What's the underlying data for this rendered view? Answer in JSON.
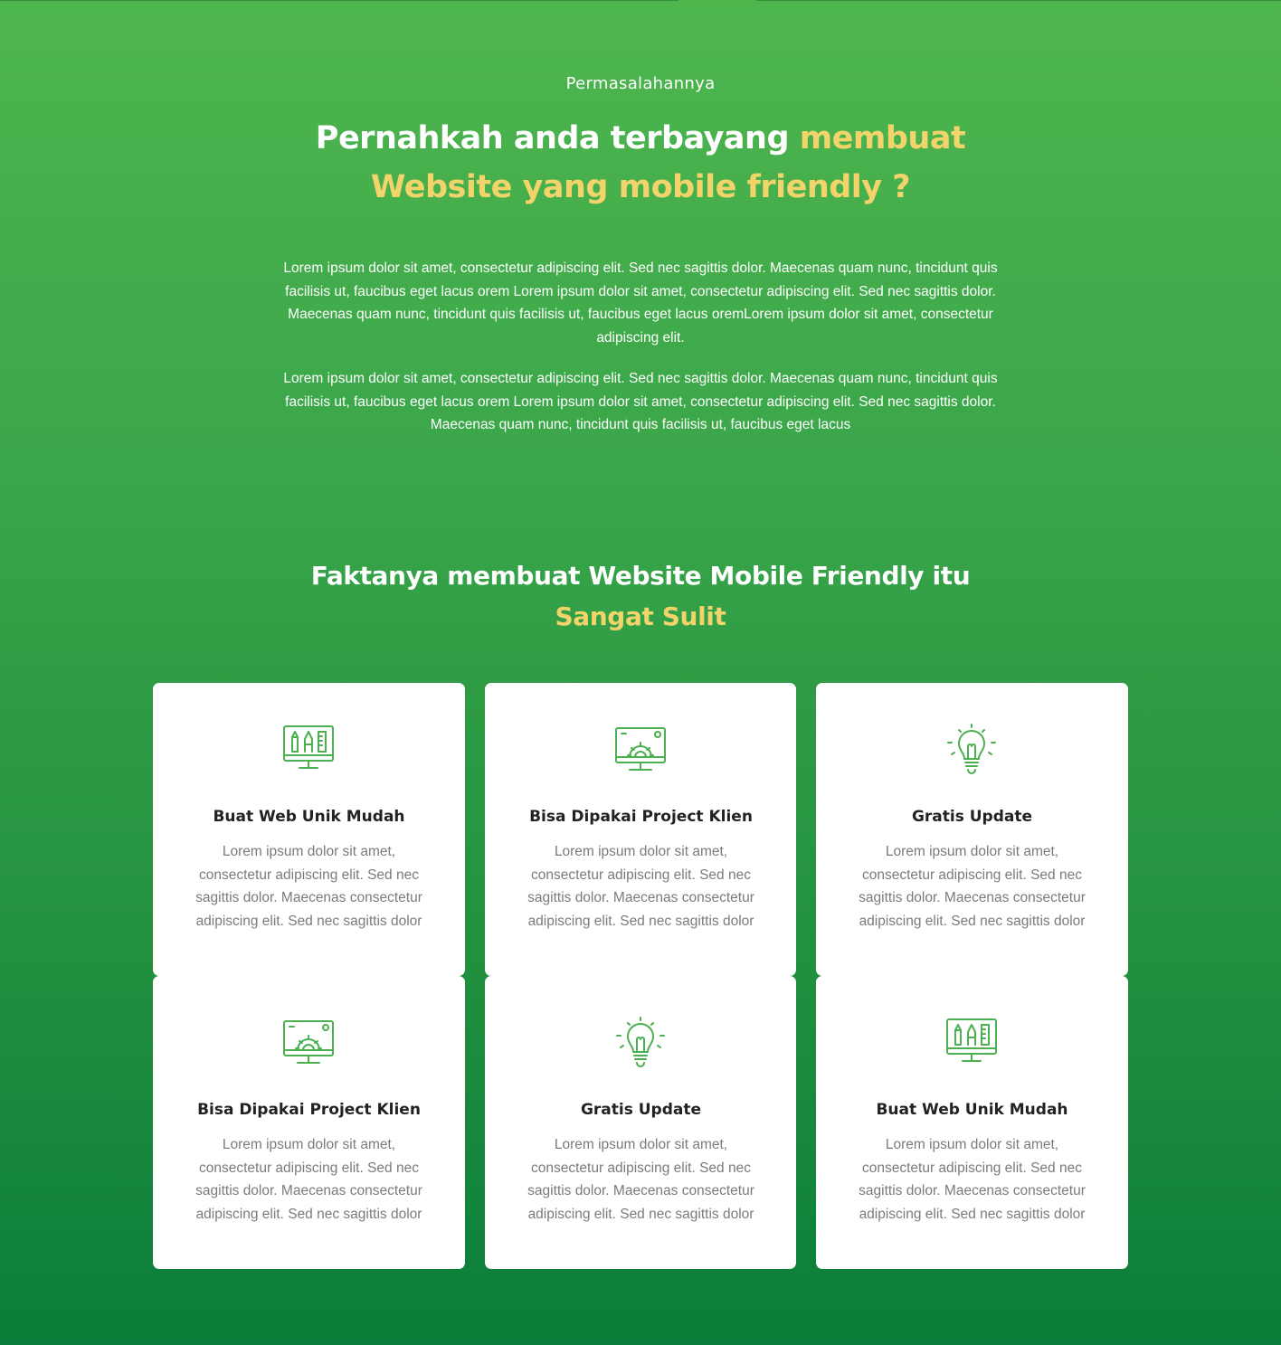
{
  "problem": {
    "eyebrow": "Permasalahannya",
    "headline_white": "Pernahkah anda terbayang ",
    "headline_highlight_1": "membuat",
    "headline_highlight_2": "Website yang mobile friendly ?",
    "paragraph_1": "Lorem ipsum dolor sit amet, consectetur adipiscing elit. Sed nec sagittis dolor. Maecenas quam nunc, tincidunt quis facilisis ut, faucibus eget lacus orem Lorem ipsum dolor sit amet, consectetur adipiscing elit. Sed nec sagittis dolor. Maecenas quam nunc, tincidunt quis facilisis ut, faucibus eget lacus oremLorem ipsum dolor sit amet, consectetur adipiscing elit.",
    "paragraph_2": "Lorem ipsum dolor sit amet, consectetur adipiscing elit. Sed nec sagittis dolor. Maecenas quam nunc, tincidunt quis facilisis ut, faucibus eget lacus orem Lorem ipsum dolor sit amet, consectetur adipiscing elit. Sed nec sagittis dolor. Maecenas quam nunc, tincidunt quis facilisis ut, faucibus eget lacus"
  },
  "facts": {
    "heading_white": "Faktanya membuat Website Mobile Friendly itu",
    "heading_highlight": "Sangat Sulit"
  },
  "colors": {
    "accent_yellow": "#f3d46b",
    "icon_green": "#4caf50",
    "background_top": "#4fb64e",
    "background_bottom": "#0b7d3a"
  },
  "cards": [
    {
      "icon": "monitor-design-tools-icon",
      "title": "Buat Web Unik Mudah",
      "desc": "Lorem ipsum dolor sit amet, consectetur adipiscing elit. Sed nec sagittis dolor. Maecenas consectetur adipiscing elit. Sed nec sagittis dolor"
    },
    {
      "icon": "monitor-gear-icon",
      "title": "Bisa Dipakai Project Klien",
      "desc": "Lorem ipsum dolor sit amet, consectetur adipiscing elit. Sed nec sagittis dolor. Maecenas consectetur adipiscing elit. Sed nec sagittis dolor"
    },
    {
      "icon": "lightbulb-icon",
      "title": "Gratis Update",
      "desc": "Lorem ipsum dolor sit amet, consectetur adipiscing elit. Sed nec sagittis dolor. Maecenas consectetur adipiscing elit. Sed nec sagittis dolor"
    },
    {
      "icon": "monitor-gear-icon",
      "title": "Bisa Dipakai Project Klien",
      "desc": "Lorem ipsum dolor sit amet, consectetur adipiscing elit. Sed nec sagittis dolor. Maecenas consectetur adipiscing elit. Sed nec sagittis dolor"
    },
    {
      "icon": "lightbulb-icon",
      "title": "Gratis Update",
      "desc": "Lorem ipsum dolor sit amet, consectetur adipiscing elit. Sed nec sagittis dolor. Maecenas consectetur adipiscing elit. Sed nec sagittis dolor"
    },
    {
      "icon": "monitor-design-tools-icon",
      "title": "Buat Web Unik Mudah",
      "desc": "Lorem ipsum dolor sit amet, consectetur adipiscing elit. Sed nec sagittis dolor. Maecenas consectetur adipiscing elit. Sed nec sagittis dolor"
    }
  ]
}
